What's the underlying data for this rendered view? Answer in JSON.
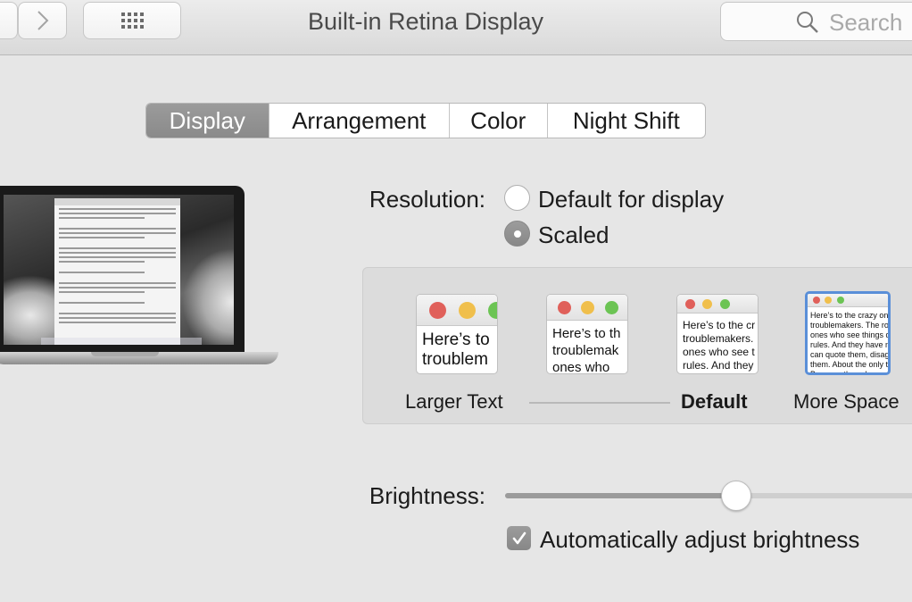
{
  "window": {
    "title": "Built-in Retina Display"
  },
  "search": {
    "placeholder": "Search"
  },
  "tabs": [
    {
      "label": "Display",
      "active": true
    },
    {
      "label": "Arrangement",
      "active": false
    },
    {
      "label": "Color",
      "active": false
    },
    {
      "label": "Night Shift",
      "active": false
    }
  ],
  "resolution": {
    "label": "Resolution:",
    "options": [
      {
        "label": "Default for display",
        "selected": false
      },
      {
        "label": "Scaled",
        "selected": true
      }
    ]
  },
  "scaling": {
    "options": [
      {
        "label": "Larger Text",
        "sample": "Here’s to\ntroublem"
      },
      {
        "label": "",
        "sample": "Here’s to th\ntroublemak\nones who"
      },
      {
        "label": "Default",
        "sample": "Here’s to the cr\ntroublemakers.\nones who see t\nrules. And they"
      },
      {
        "label": "More Space",
        "sample": "Here’s to the crazy ones\ntroublemakers. The rou\nones who see things dif\nrules. And they have no\ncan quote them, disagre\nthem. About the only th\nBecause they change th"
      }
    ],
    "selected_index": 3
  },
  "brightness": {
    "label": "Brightness:",
    "value": 0.55,
    "auto_label": "Automatically adjust brightness",
    "auto_checked": true
  },
  "colors": {
    "accent": "#5a8fd8",
    "close": "#e0605a",
    "minimize": "#f0bf4c",
    "zoom": "#6cc454"
  },
  "icons": [
    "chevron-left-icon",
    "chevron-right-icon",
    "grid-icon",
    "search-icon",
    "checkmark-icon"
  ]
}
